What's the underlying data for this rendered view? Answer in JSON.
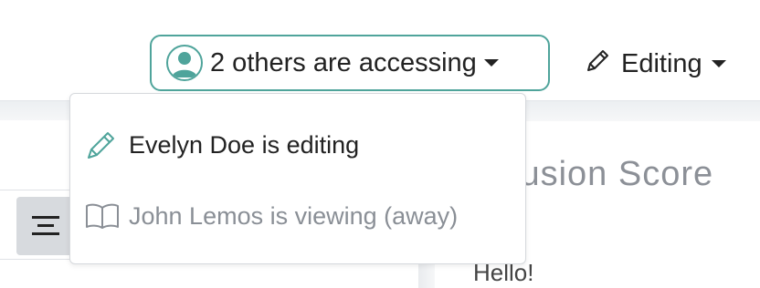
{
  "header": {
    "access_button_label": "2 others are accessing",
    "editing_button_label": "Editing"
  },
  "access_dropdown": {
    "items": [
      {
        "label": "Evelyn Doe is editing",
        "icon": "pencil-icon",
        "color": "#222222"
      },
      {
        "label": "John Lemos is viewing (away)",
        "icon": "book-icon",
        "color": "#8a8f96"
      }
    ]
  },
  "document": {
    "title_fragment": "lusion Score",
    "body_text": "Hello!"
  },
  "colors": {
    "accent": "#4fa49b",
    "text": "#222222",
    "muted": "#8a8f96"
  }
}
